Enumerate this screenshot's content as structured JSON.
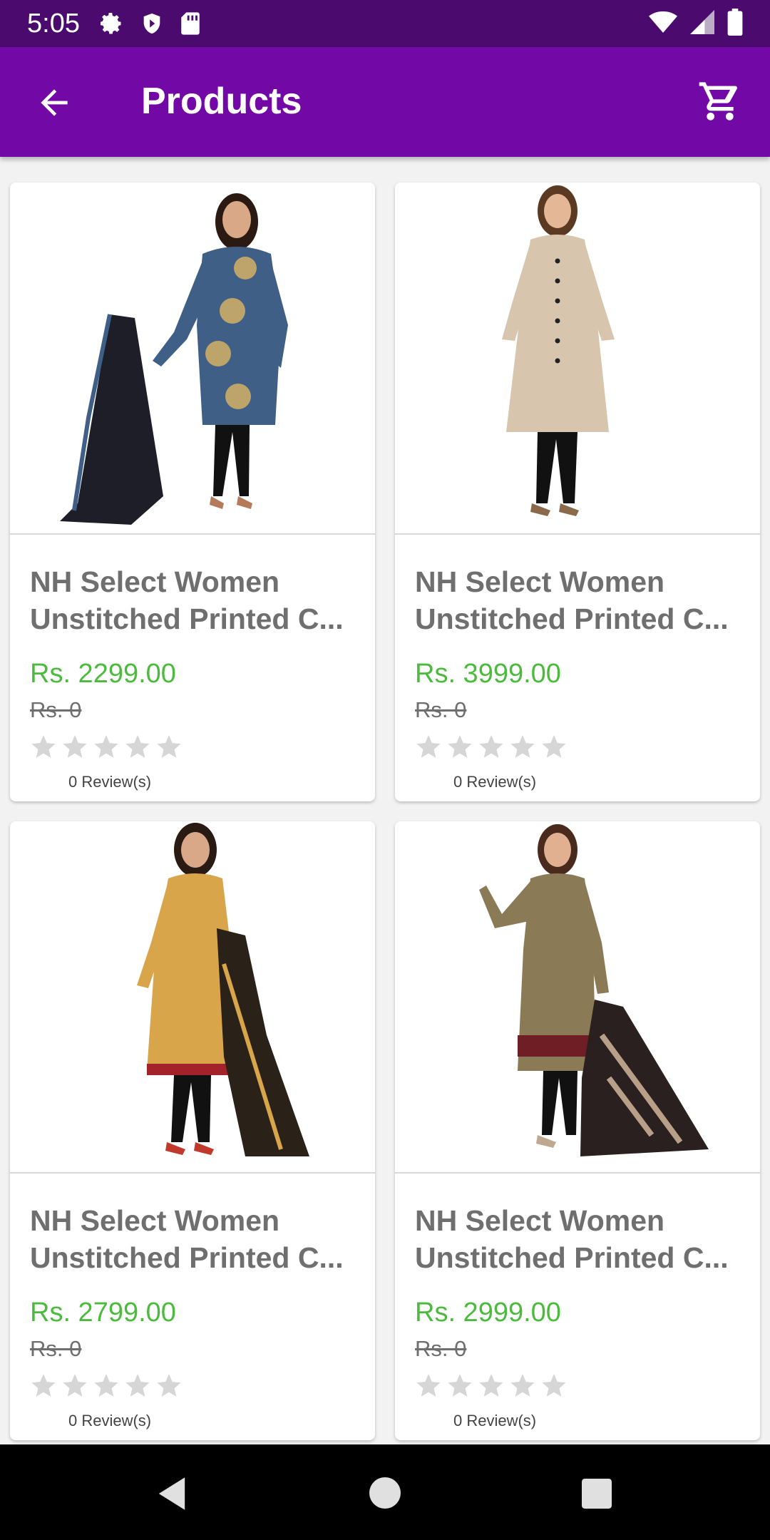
{
  "status_bar": {
    "time": "5:05",
    "left_icons": [
      "gear-icon",
      "shield-icon",
      "sd-card-icon"
    ],
    "right_icons": [
      "wifi-icon",
      "signal-icon",
      "battery-icon"
    ]
  },
  "app_bar": {
    "title": "Products",
    "back_icon": "arrow-left-icon",
    "cart_icon": "cart-icon",
    "background": "#7209a6"
  },
  "products": [
    {
      "title": "NH Select Women Unstitched Printed C...",
      "price": "Rs. 2299.00",
      "old_price": "Rs. 0",
      "rating": 0,
      "reviews": "0 Review(s)",
      "dress_color": "#3f5f86",
      "dupatta_color": "#1e1e28"
    },
    {
      "title": "NH Select Women Unstitched Printed C...",
      "price": "Rs. 3999.00",
      "old_price": "Rs. 0",
      "rating": 0,
      "reviews": "0 Review(s)",
      "dress_color": "#d7c6ad",
      "dupatta_color": ""
    },
    {
      "title": "NH Select Women Unstitched Printed C...",
      "price": "Rs. 2799.00",
      "old_price": "Rs. 0",
      "rating": 0,
      "reviews": "0 Review(s)",
      "dress_color": "#d9a54a",
      "dupatta_color": "#2a2218"
    },
    {
      "title": "NH Select Women Unstitched Printed C...",
      "price": "Rs. 2999.00",
      "old_price": "Rs. 0",
      "rating": 0,
      "reviews": "0 Review(s)",
      "dress_color": "#8a7a56",
      "dupatta_color": "#2a2020"
    }
  ],
  "colors": {
    "price_green": "#4cbb3d",
    "star_gray": "#d6d6d6",
    "status_bar": "#4a0a6e"
  },
  "nav_bar": {
    "back_icon": "nav-back-icon",
    "home_icon": "nav-home-icon",
    "recents_icon": "nav-recents-icon"
  }
}
